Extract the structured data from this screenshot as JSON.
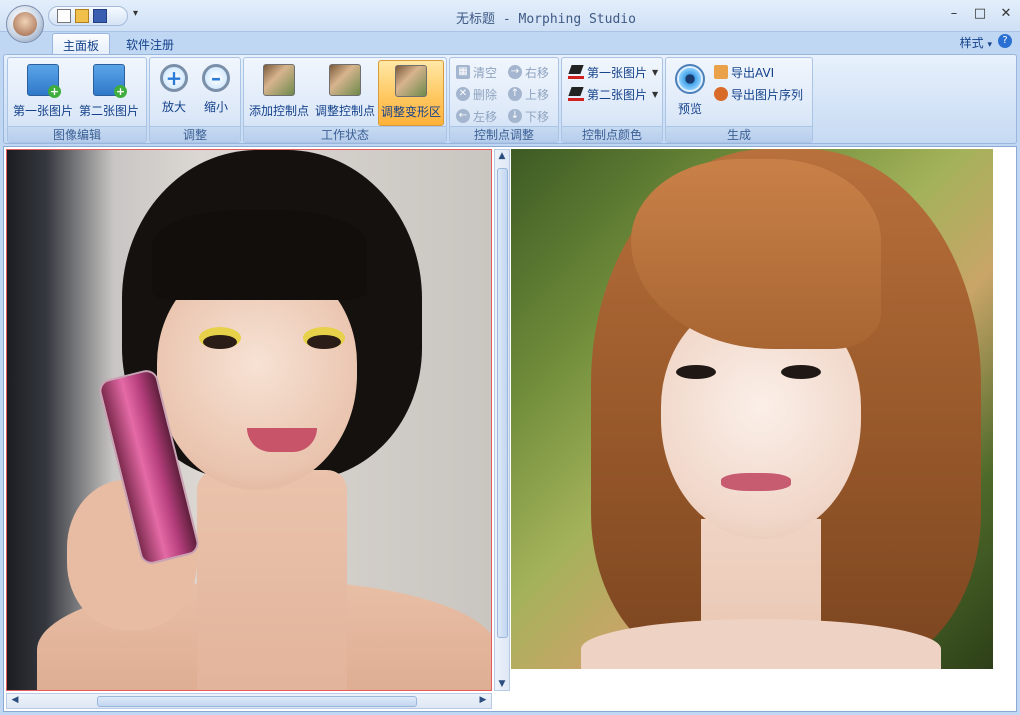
{
  "window": {
    "title": "无标题 - Morphing Studio",
    "minimize": "–",
    "maximize": "□",
    "close": "✕"
  },
  "tabs": [
    {
      "label": "主面板",
      "active": true
    },
    {
      "label": "软件注册",
      "active": false
    }
  ],
  "style_menu": "样式",
  "style_menu_arrow": "▾",
  "help": "?",
  "ribbon": {
    "image_edit": {
      "label": "图像编辑",
      "buttons": [
        "第一张图片",
        "第二张图片"
      ]
    },
    "adjust": {
      "label": "调整",
      "buttons": [
        "放大",
        "缩小"
      ]
    },
    "work_state": {
      "label": "工作状态",
      "buttons": [
        "添加控制点",
        "调整控制点",
        "调整变形区"
      ],
      "active_index": 2
    },
    "point_adjust": {
      "label": "控制点调整",
      "buttons": [
        "清空",
        "右移",
        "删除",
        "上移",
        "左移",
        "下移"
      ]
    },
    "point_color": {
      "label": "控制点颜色",
      "buttons": [
        "第一张图片",
        "第二张图片"
      ],
      "pen_color": "#d02020"
    },
    "generate": {
      "label": "生成",
      "preview": "预览",
      "export_avi": "导出AVI",
      "export_seq": "导出图片序列"
    }
  },
  "colors": {
    "accent": "#15428b",
    "active_button": "#ffc862",
    "selection_border": "#e45c5c"
  }
}
